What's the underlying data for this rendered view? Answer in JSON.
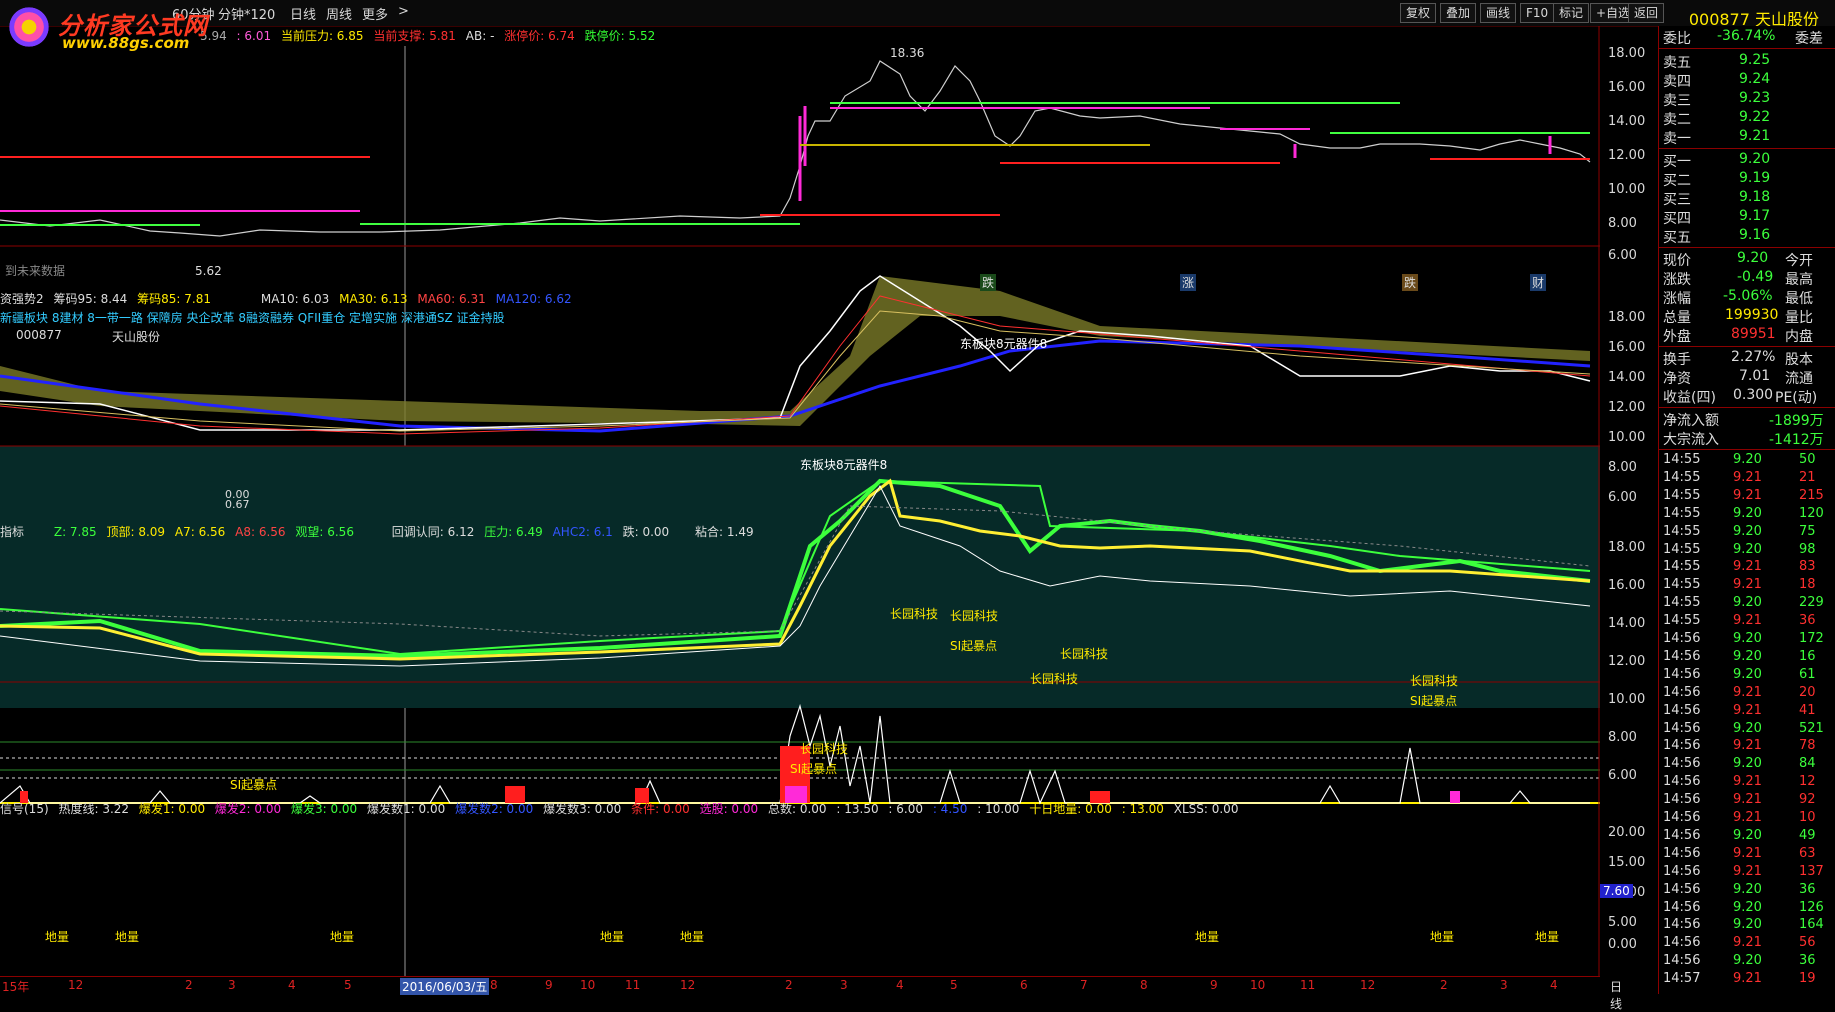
{
  "logo": {
    "name": "分析家公式网",
    "url": "www.88gs.com"
  },
  "toolbar": {
    "periods": [
      "60分钟",
      "分钟*120",
      "日线",
      "周线",
      "更多",
      ">"
    ],
    "buttons": [
      "复权",
      "叠加",
      "画线",
      "F10",
      "标记",
      "+自选",
      "返回"
    ],
    "stock_title": "000877 天山股份"
  },
  "main_panel": {
    "info": [
      "5.94",
      ": 6.01",
      "当前压力: 6.85",
      "当前支撑: 5.81",
      "AB: -",
      "涨停价: 6.74",
      "跌停价: 5.52"
    ],
    "high_label": "18.36",
    "low_label": "5.62",
    "note": "到未来数据",
    "ticks": [
      "18.00",
      "16.00",
      "14.00",
      "12.00",
      "10.00",
      "8.00",
      "6.00"
    ],
    "event_labels": [
      "跌",
      "涨",
      "跌",
      "财"
    ]
  },
  "panel2": {
    "line1": [
      "资强势2",
      "筹码95: 8.44",
      "筹码85: 7.81",
      "MA10: 6.03",
      "MA30: 6.13",
      "MA60: 6.31",
      "MA120: 6.62"
    ],
    "line2": "新疆板块 8建材 8一带一路 保障房 央企改革 8融资融券 QFII重仓 定增实施 深港通SZ 证金持股",
    "code": "000877",
    "name": "天山股份",
    "annot1": "东板块8元器件8",
    "annot2": "东板块8元器件8",
    "low_val": "0.00",
    "low_val2": "0.67",
    "ticks": [
      "18.00",
      "16.00",
      "14.00",
      "12.00",
      "10.00",
      "8.00",
      "6.00"
    ]
  },
  "panel3": {
    "line": [
      "指标",
      "Z: 7.85",
      "顶部: 8.09",
      "A7: 6.56",
      "A8: 6.56",
      "观望: 6.56",
      "回调认同: 6.12",
      "压力: 6.49",
      "AHC2: 6.1",
      "跌: 0.00",
      "粘合: 1.49"
    ],
    "labels": [
      "长园科技",
      "长园科技",
      "长园科技",
      "长园科技",
      "长园科技",
      "长园科技",
      "SI起暴点",
      "SI起暴点",
      "SI起暴点",
      "SI起暴点"
    ],
    "ticks": [
      "18.00",
      "16.00",
      "14.00",
      "12.00",
      "10.00",
      "8.00",
      "6.00"
    ]
  },
  "panel4": {
    "line": [
      "信号(15)",
      "热度线: 3.22",
      "爆发1: 0.00",
      "爆发2: 0.00",
      "爆发3: 0.00",
      "爆发数1: 0.00",
      "爆发数2: 0.00",
      "爆发数3: 0.00",
      "条件: 0.00",
      "选股: 0.00",
      "总数: 0.00",
      ": 13.50",
      ": 6.00",
      ": 4.50",
      ": 10.00",
      "十日地量: 0.00",
      ": 13.00",
      "XLSS: 0.00"
    ],
    "ticks": [
      "20.00",
      "15.00",
      "10.00",
      "5.00",
      "0.00"
    ],
    "marker": "7.60",
    "labels": [
      "地量",
      "地量",
      "地量",
      "地量",
      "地量",
      "地量",
      "地量",
      "地量"
    ]
  },
  "bottom": {
    "months": [
      "15年",
      "12",
      "2",
      "3",
      "4",
      "5",
      "2016/06/03/五",
      "8",
      "9",
      "10",
      "11",
      "12",
      "2",
      "3",
      "4",
      "5",
      "6",
      "7",
      "8",
      "9",
      "10",
      "11",
      "12",
      "2",
      "3",
      "4"
    ],
    "right_label": "日线"
  },
  "quote": {
    "weibi": {
      "label": "委比",
      "value": "-36.74%",
      "label2": "委差"
    },
    "asks": [
      {
        "label": "卖五",
        "price": "9.25"
      },
      {
        "label": "卖四",
        "price": "9.24"
      },
      {
        "label": "卖三",
        "price": "9.23"
      },
      {
        "label": "卖二",
        "price": "9.22"
      },
      {
        "label": "卖一",
        "price": "9.21"
      }
    ],
    "bids": [
      {
        "label": "买一",
        "price": "9.20"
      },
      {
        "label": "买二",
        "price": "9.19"
      },
      {
        "label": "买三",
        "price": "9.18"
      },
      {
        "label": "买四",
        "price": "9.17"
      },
      {
        "label": "买五",
        "price": "9.16"
      }
    ],
    "stats": [
      {
        "l": "现价",
        "v": "9.20",
        "l2": "今开"
      },
      {
        "l": "涨跌",
        "v": "-0.49",
        "l2": "最高"
      },
      {
        "l": "涨幅",
        "v": "-5.06%",
        "l2": "最低"
      },
      {
        "l": "总量",
        "v": "199930",
        "l2": "量比"
      },
      {
        "l": "外盘",
        "v": "89951",
        "l2": "内盘"
      },
      {
        "l": "换手",
        "v": "2.27%",
        "l2": "股本"
      },
      {
        "l": "净资",
        "v": "7.01",
        "l2": "流通"
      },
      {
        "l": "收益(四)",
        "v": "0.300",
        "l2": "PE(动)"
      },
      {
        "l": "净流入额",
        "v": "-1899万",
        "l2": ""
      },
      {
        "l": "大宗流入",
        "v": "-1412万",
        "l2": ""
      }
    ],
    "trades": [
      [
        "14:55",
        "9.20",
        "50"
      ],
      [
        "14:55",
        "9.21",
        "21"
      ],
      [
        "14:55",
        "9.21",
        "215"
      ],
      [
        "14:55",
        "9.20",
        "120"
      ],
      [
        "14:55",
        "9.20",
        "75"
      ],
      [
        "14:55",
        "9.20",
        "98"
      ],
      [
        "14:55",
        "9.21",
        "83"
      ],
      [
        "14:55",
        "9.21",
        "18"
      ],
      [
        "14:55",
        "9.20",
        "229"
      ],
      [
        "14:55",
        "9.21",
        "36"
      ],
      [
        "14:56",
        "9.20",
        "172"
      ],
      [
        "14:56",
        "9.20",
        "16"
      ],
      [
        "14:56",
        "9.20",
        "61"
      ],
      [
        "14:56",
        "9.21",
        "20"
      ],
      [
        "14:56",
        "9.21",
        "41"
      ],
      [
        "14:56",
        "9.20",
        "521"
      ],
      [
        "14:56",
        "9.21",
        "78"
      ],
      [
        "14:56",
        "9.20",
        "84"
      ],
      [
        "14:56",
        "9.21",
        "12"
      ],
      [
        "14:56",
        "9.21",
        "92"
      ],
      [
        "14:56",
        "9.21",
        "10"
      ],
      [
        "14:56",
        "9.20",
        "49"
      ],
      [
        "14:56",
        "9.21",
        "63"
      ],
      [
        "14:56",
        "9.21",
        "137"
      ],
      [
        "14:56",
        "9.20",
        "36"
      ],
      [
        "14:56",
        "9.20",
        "126"
      ],
      [
        "14:56",
        "9.20",
        "164"
      ],
      [
        "14:56",
        "9.21",
        "56"
      ],
      [
        "14:56",
        "9.20",
        "36"
      ],
      [
        "14:57",
        "9.21",
        "19"
      ]
    ]
  }
}
